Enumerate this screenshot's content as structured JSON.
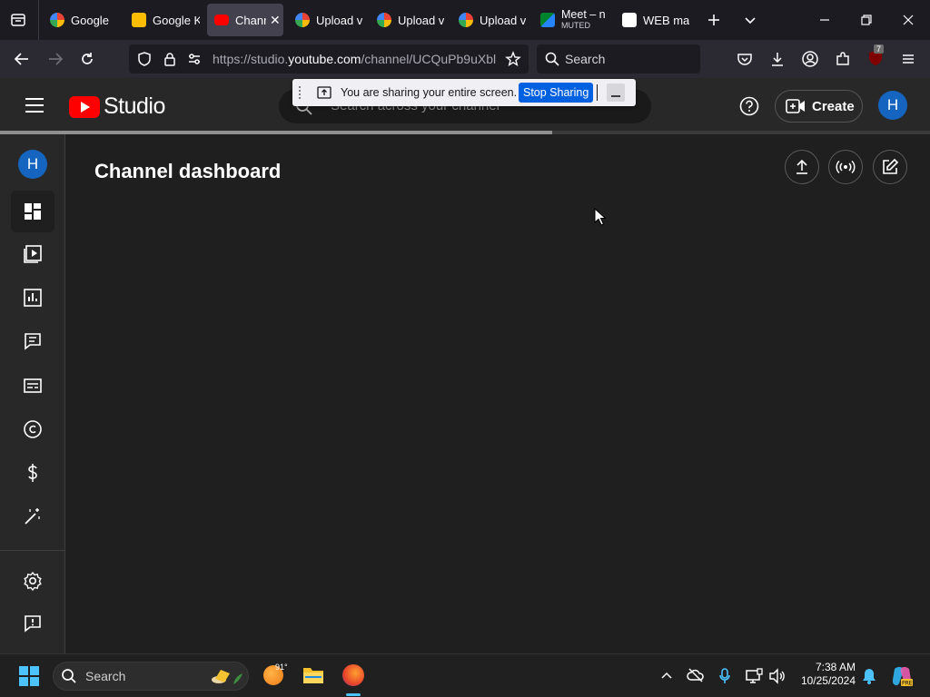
{
  "browser": {
    "tabs": [
      {
        "label": "Google",
        "icon": "google-icon",
        "active": false
      },
      {
        "label": "Google K",
        "icon": "keep-icon",
        "active": false
      },
      {
        "label": "Chann",
        "icon": "youtube-icon",
        "active": true
      },
      {
        "label": "Upload v",
        "icon": "google-icon",
        "active": false
      },
      {
        "label": "Upload v",
        "icon": "google-icon",
        "active": false
      },
      {
        "label": "Upload v",
        "icon": "google-icon",
        "active": false
      },
      {
        "label": "Meet – n",
        "sublabel": "MUTED",
        "icon": "meet-icon",
        "active": false
      },
      {
        "label": "WEB ma",
        "icon": "web-icon",
        "active": false
      }
    ],
    "url_prefix": "https://studio.",
    "url_domain": "youtube.com",
    "url_suffix": "/channel/UCQuPb9uXbl",
    "search_placeholder": "Search",
    "extension_badge": "7"
  },
  "share_banner": {
    "message": "You are sharing your entire screen.",
    "stop_label": "Stop Sharing"
  },
  "studio": {
    "logo_text": "Studio",
    "search_placeholder": "Search across your channel",
    "create_label": "Create",
    "avatar_letter": "H",
    "page_title": "Channel dashboard",
    "sidebar_avatar_letter": "H"
  },
  "taskbar": {
    "search_placeholder": "Search",
    "weather_temp": "91°",
    "time": "7:38 AM",
    "date": "10/25/2024"
  },
  "colors": {
    "youtube_red": "#ff0000",
    "avatar_blue": "#1565c0",
    "stop_sharing_blue": "#0061e0",
    "studio_bg": "#1f1f1f",
    "header_bg": "#282828"
  }
}
